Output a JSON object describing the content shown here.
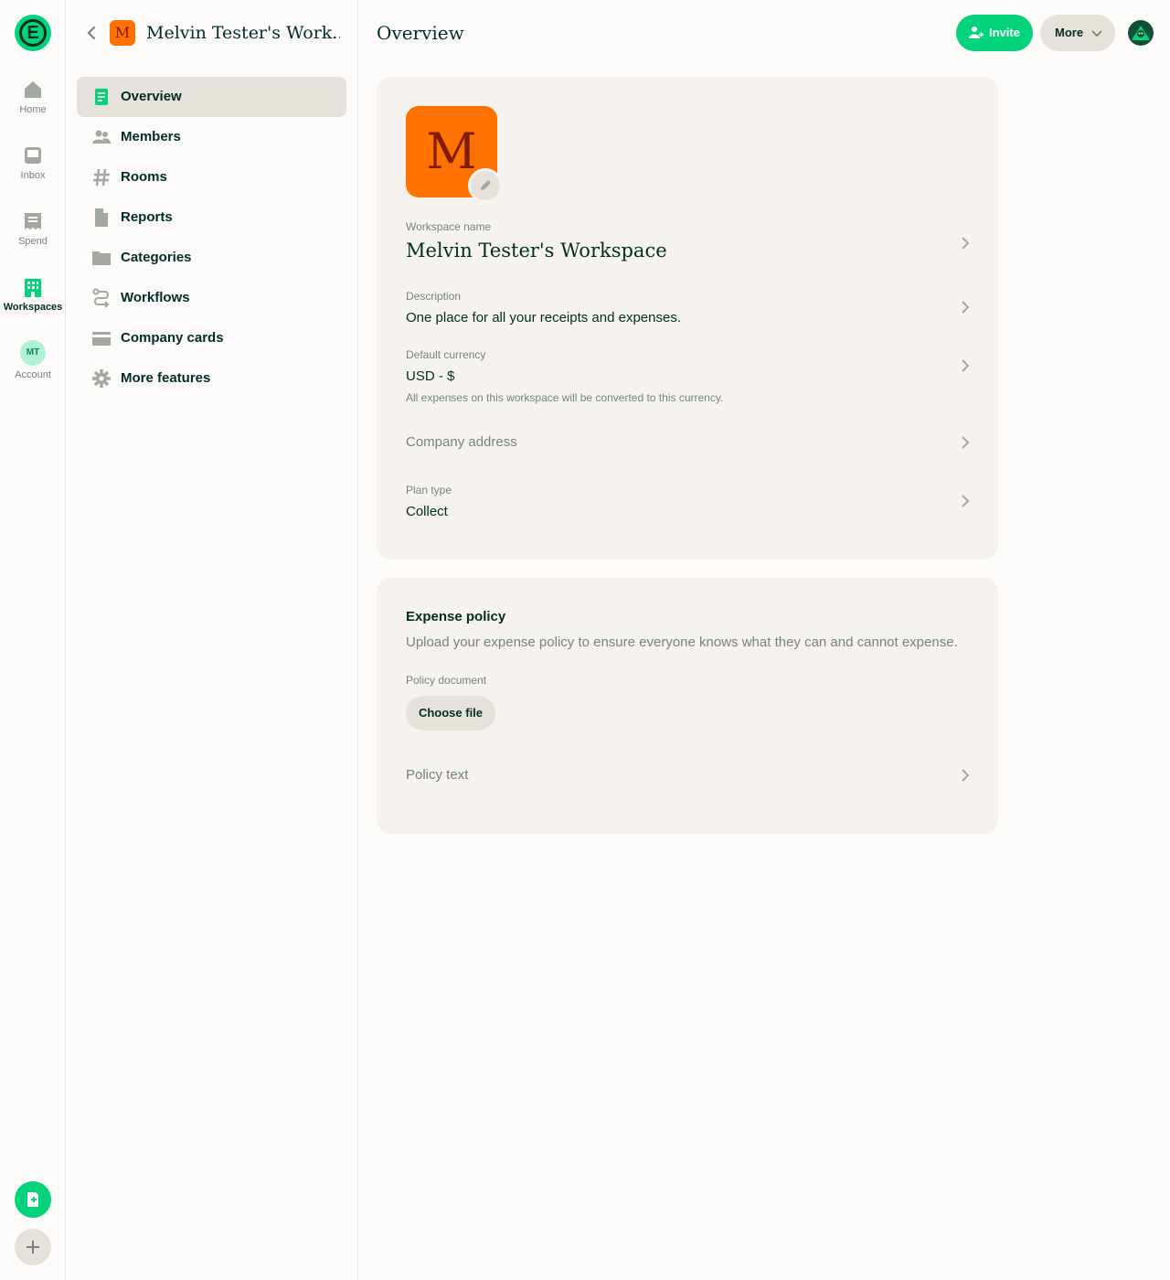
{
  "rail": {
    "logo_letter": "E",
    "items": [
      {
        "label": "Home",
        "icon": "home-icon"
      },
      {
        "label": "Inbox",
        "icon": "inbox-icon"
      },
      {
        "label": "Spend",
        "icon": "receipt-icon"
      },
      {
        "label": "Workspaces",
        "icon": "building-icon"
      },
      {
        "label": "Account",
        "icon": "avatar",
        "initials": "MT"
      }
    ]
  },
  "sidebar": {
    "workspace_initial": "M",
    "workspace_title": "Melvin Tester's Work...",
    "items": [
      {
        "label": "Overview",
        "icon": "document-icon",
        "active": true
      },
      {
        "label": "Members",
        "icon": "users-icon"
      },
      {
        "label": "Rooms",
        "icon": "hashtag-icon"
      },
      {
        "label": "Reports",
        "icon": "file-icon"
      },
      {
        "label": "Categories",
        "icon": "folder-icon"
      },
      {
        "label": "Workflows",
        "icon": "workflow-icon"
      },
      {
        "label": "Company cards",
        "icon": "credit-card-icon"
      },
      {
        "label": "More features",
        "icon": "gear-icon"
      }
    ]
  },
  "header": {
    "title": "Overview",
    "invite_label": "Invite",
    "more_label": "More"
  },
  "overview": {
    "logo_initial": "M",
    "name_label": "Workspace name",
    "name_value": "Melvin Tester's Workspace",
    "description_label": "Description",
    "description_value": "One place for all your receipts and expenses.",
    "currency_label": "Default currency",
    "currency_value": "USD - $",
    "currency_hint": "All expenses on this workspace will be converted to this currency.",
    "address_placeholder": "Company address",
    "plan_label": "Plan type",
    "plan_value": "Collect"
  },
  "expense_policy": {
    "title": "Expense policy",
    "subtitle": "Upload your expense policy to ensure everyone knows what they can and cannot expense.",
    "document_label": "Policy document",
    "choose_file_label": "Choose file",
    "policy_text_placeholder": "Policy text"
  },
  "colors": {
    "accent": "#03d47c",
    "text": "#002e22",
    "muted": "#76847e",
    "workspace_badge": "#ff7101",
    "card_bg": "#f6f3ef"
  }
}
